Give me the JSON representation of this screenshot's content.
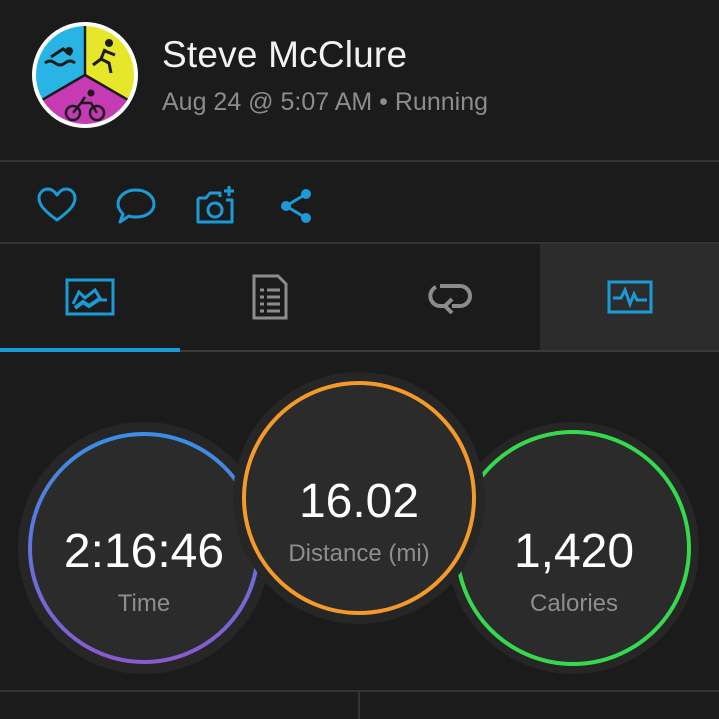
{
  "profile": {
    "name": "Steve McClure",
    "meta": "Aug 24 @ 5:07 AM • Running"
  },
  "actions": [
    {
      "icon": "heart-icon"
    },
    {
      "icon": "comment-icon"
    },
    {
      "icon": "add-photo-icon"
    },
    {
      "icon": "share-icon"
    }
  ],
  "tabs": [
    {
      "icon": "map-tab-icon",
      "selected": true
    },
    {
      "icon": "details-tab-icon",
      "selected": false
    },
    {
      "icon": "laps-tab-icon",
      "selected": false
    },
    {
      "icon": "chart-tab-icon",
      "selected": false
    }
  ],
  "colors": {
    "accent": "#1a9bd7",
    "time_ring_start": "#3a8ee6",
    "time_ring_end": "#8a5ad0",
    "distance_ring": "#f39a2b",
    "calories_ring": "#36d94e"
  },
  "stats": {
    "time": {
      "value": "2:16:46",
      "label": "Time"
    },
    "distance": {
      "value": "16.02",
      "label": "Distance (mi)"
    },
    "calories": {
      "value": "1,420",
      "label": "Calories"
    }
  }
}
